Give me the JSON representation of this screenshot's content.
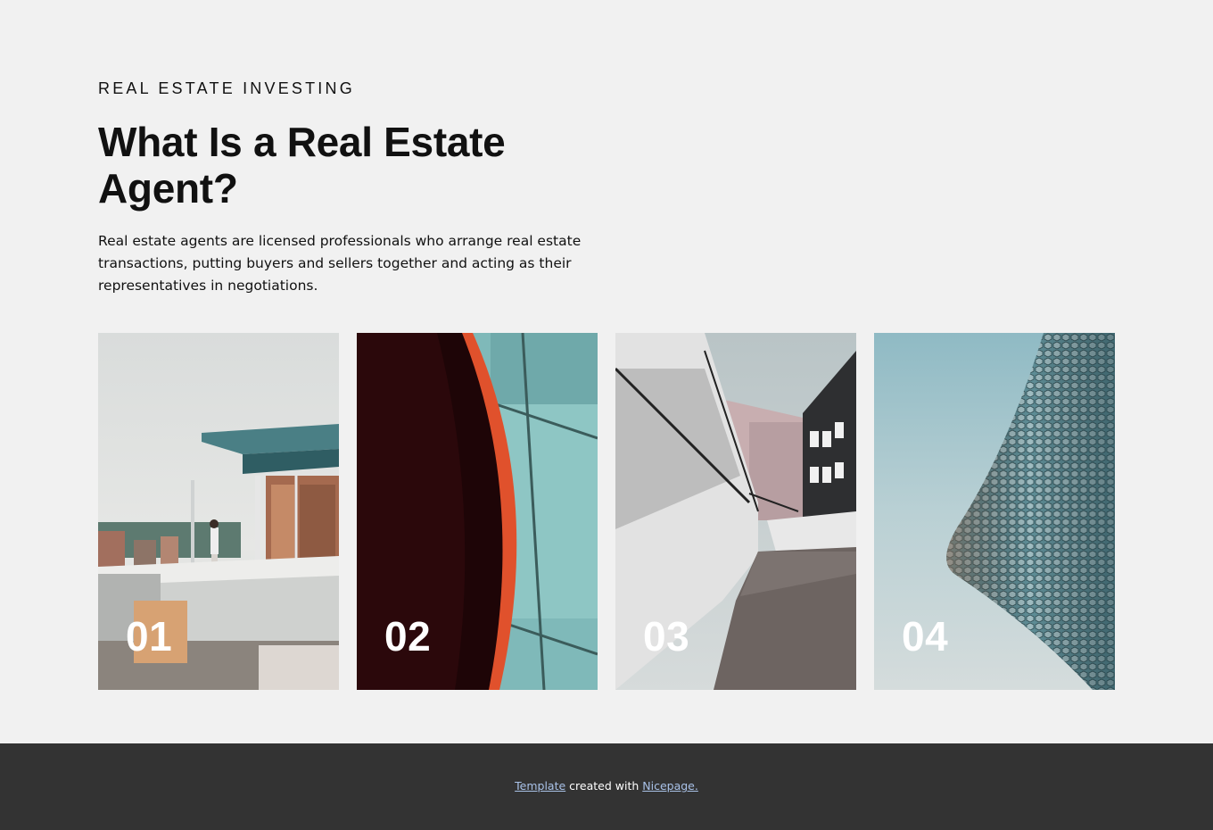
{
  "section": {
    "eyebrow": "REAL ESTATE INVESTING",
    "title": "What Is a Real Estate Agent?",
    "description": "Real estate agents are licensed professionals who arrange real estate transactions, putting buyers and sellers together and acting as their representatives in negotiations."
  },
  "cards": [
    {
      "number": "01"
    },
    {
      "number": "02"
    },
    {
      "number": "03"
    },
    {
      "number": "04"
    }
  ],
  "footer": {
    "link1": "Template",
    "middle": " created with ",
    "link2": "Nicepage."
  },
  "colors": {
    "background": "#f1f1f1",
    "footer_background": "#333333",
    "footer_link": "#a9c2e8"
  }
}
